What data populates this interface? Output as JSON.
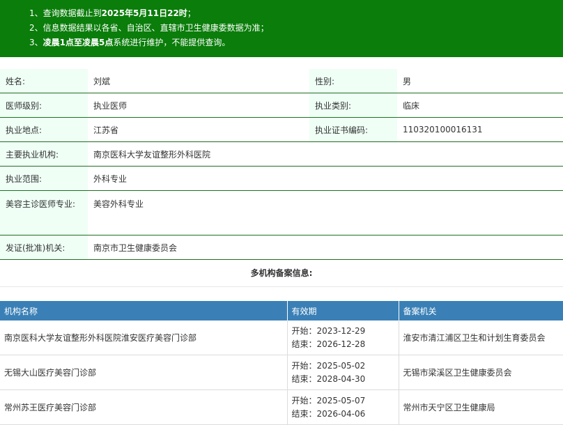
{
  "notice": {
    "lines": [
      {
        "prefix": "1、查询数据截止到",
        "bold": "2025年5月11日22时",
        "suffix": "；"
      },
      {
        "prefix": "2、信息数据结果以各省、自治区、直辖市卫生健康委数据为准；",
        "bold": "",
        "suffix": ""
      },
      {
        "prefix": "3、",
        "bold": "凌晨1点至凌晨5点",
        "suffix": "系统进行维护，不能提供查询。"
      }
    ]
  },
  "info": {
    "name_label": "姓名:",
    "name": "刘斌",
    "gender_label": "性别:",
    "gender": "男",
    "level_label": "医师级别:",
    "level": "执业医师",
    "category_label": "执业类别:",
    "category": "临床",
    "location_label": "执业地点:",
    "location": "江苏省",
    "cert_label": "执业证书编码:",
    "cert": "110320100016131",
    "main_org_label": "主要执业机构:",
    "main_org": "南京医科大学友谊整形外科医院",
    "scope_label": "执业范围:",
    "scope": "外科专业",
    "beauty_label": "美容主诊医师专业:",
    "beauty": "美容外科专业",
    "issuer_label": "发证(批准)机关:",
    "issuer": "南京市卫生健康委员会"
  },
  "multi_title": "多机构备案信息:",
  "org_table": {
    "headers": [
      "机构名称",
      "有效期",
      "备案机关"
    ],
    "start_label": "开始：",
    "end_label": "结束：",
    "rows": [
      {
        "name": "南京医科大学友谊整形外科医院淮安医疗美容门诊部",
        "start": "2023-12-29",
        "end": "2026-12-28",
        "authority": "淮安市清江浦区卫生和计划生育委员会"
      },
      {
        "name": "无锡大山医疗美容门诊部",
        "start": "2025-05-02",
        "end": "2028-04-30",
        "authority": "无锡市梁溪区卫生健康委员会"
      },
      {
        "name": "常州苏王医疗美容门诊部",
        "start": "2025-05-07",
        "end": "2026-04-06",
        "authority": "常州市天宁区卫生健康局"
      }
    ]
  }
}
